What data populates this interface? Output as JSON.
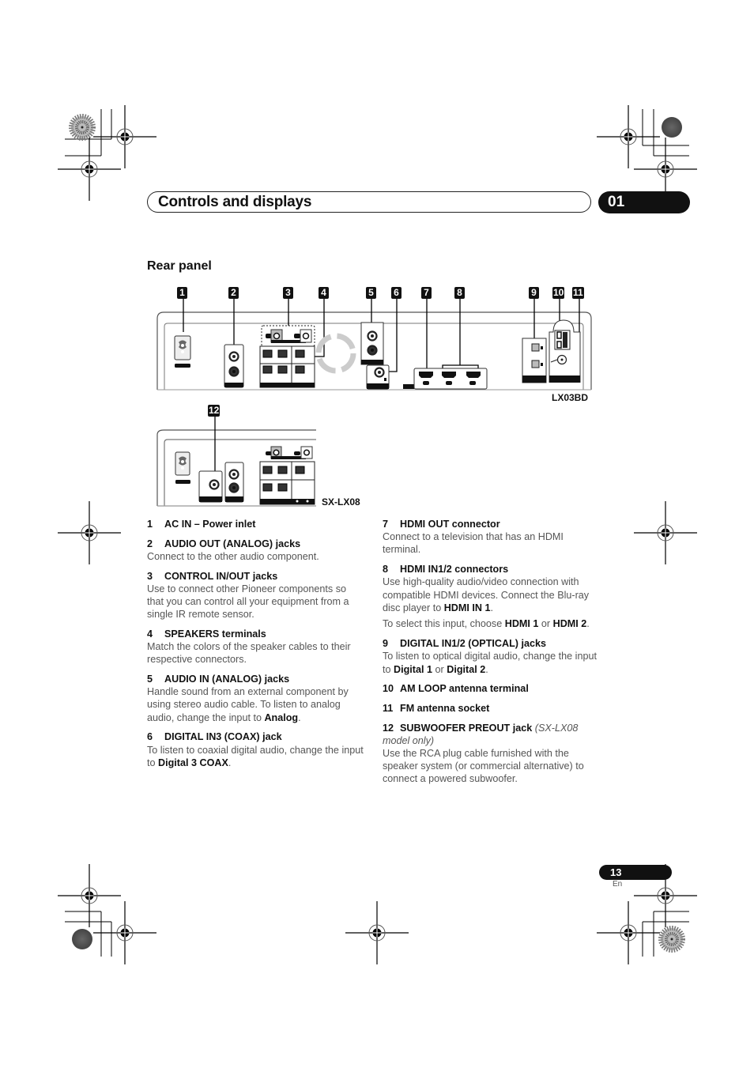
{
  "header": {
    "title": "Controls and displays",
    "chapter": "01"
  },
  "section": {
    "title": "Rear panel"
  },
  "diagram": {
    "callouts": [
      "1",
      "2",
      "3",
      "4",
      "5",
      "6",
      "7",
      "8",
      "9",
      "10",
      "11",
      "12"
    ],
    "models": {
      "main": "LX03BD",
      "sub": "SX-LX08"
    },
    "icons": {
      "ac_inlet": "ac-power-inlet-icon",
      "rca_jack": "rca-jack-icon",
      "speaker_terminal": "speaker-terminal-icon",
      "hdmi_port": "hdmi-port-icon",
      "optical_jack": "optical-jack-icon",
      "am_terminal": "am-antenna-terminal-icon",
      "fm_socket": "fm-antenna-socket-icon",
      "fan": "cooling-fan-icon"
    }
  },
  "items_left": [
    {
      "num": "1",
      "title": "AC IN – Power inlet",
      "body": []
    },
    {
      "num": "2",
      "title": "AUDIO OUT (ANALOG) jacks",
      "body": [
        [
          {
            "t": "Connect to the other audio component."
          }
        ]
      ]
    },
    {
      "num": "3",
      "title": "CONTROL IN/OUT jacks",
      "body": [
        [
          {
            "t": "Use to connect other Pioneer components so that you can control all your equipment from a single IR remote sensor."
          }
        ]
      ]
    },
    {
      "num": "4",
      "title": "SPEAKERS terminals",
      "body": [
        [
          {
            "t": "Match the colors of the speaker cables to their respective connectors."
          }
        ]
      ]
    },
    {
      "num": "5",
      "title": "AUDIO IN (ANALOG) jacks",
      "body": [
        [
          {
            "t": "Handle sound from an external component by using stereo audio cable. To listen to analog audio, change the input to "
          },
          {
            "t": "Analog",
            "b": true
          },
          {
            "t": "."
          }
        ]
      ]
    },
    {
      "num": "6",
      "title": "DIGITAL IN3 (COAX) jack",
      "body": [
        [
          {
            "t": "To listen to coaxial digital audio, change the input to "
          },
          {
            "t": "Digital 3 COAX",
            "b": true
          },
          {
            "t": "."
          }
        ]
      ]
    }
  ],
  "items_right": [
    {
      "num": "7",
      "title": "HDMI OUT connector",
      "body": [
        [
          {
            "t": "Connect to a television that has an HDMI terminal."
          }
        ]
      ]
    },
    {
      "num": "8",
      "title": "HDMI IN1/2 connectors",
      "body": [
        [
          {
            "t": "Use high-quality audio/video connection with compatible HDMI devices. Connect the Blu-ray disc player to "
          },
          {
            "t": "HDMI IN 1",
            "b": true
          },
          {
            "t": "."
          }
        ],
        [
          {
            "t": "To select this input, choose "
          },
          {
            "t": "HDMI 1",
            "b": true
          },
          {
            "t": " or "
          },
          {
            "t": "HDMI 2",
            "b": true
          },
          {
            "t": "."
          }
        ]
      ]
    },
    {
      "num": "9",
      "title": "DIGITAL IN1/2 (OPTICAL) jacks",
      "body": [
        [
          {
            "t": "To listen to optical digital audio, change the input to "
          },
          {
            "t": "Digital 1",
            "b": true
          },
          {
            "t": " or "
          },
          {
            "t": "Digital 2",
            "b": true
          },
          {
            "t": "."
          }
        ]
      ]
    },
    {
      "num": "10",
      "title": "AM LOOP antenna terminal",
      "body": []
    },
    {
      "num": "11",
      "title": "FM antenna socket",
      "body": []
    },
    {
      "num": "12",
      "title": "SUBWOOFER PREOUT jack",
      "note": "(SX-LX08 model only)",
      "body": [
        [
          {
            "t": "Use the RCA plug cable furnished with the speaker system (or commercial alternative) to connect a powered subwoofer."
          }
        ]
      ]
    }
  ],
  "footer": {
    "page_number": "13",
    "language": "En"
  }
}
